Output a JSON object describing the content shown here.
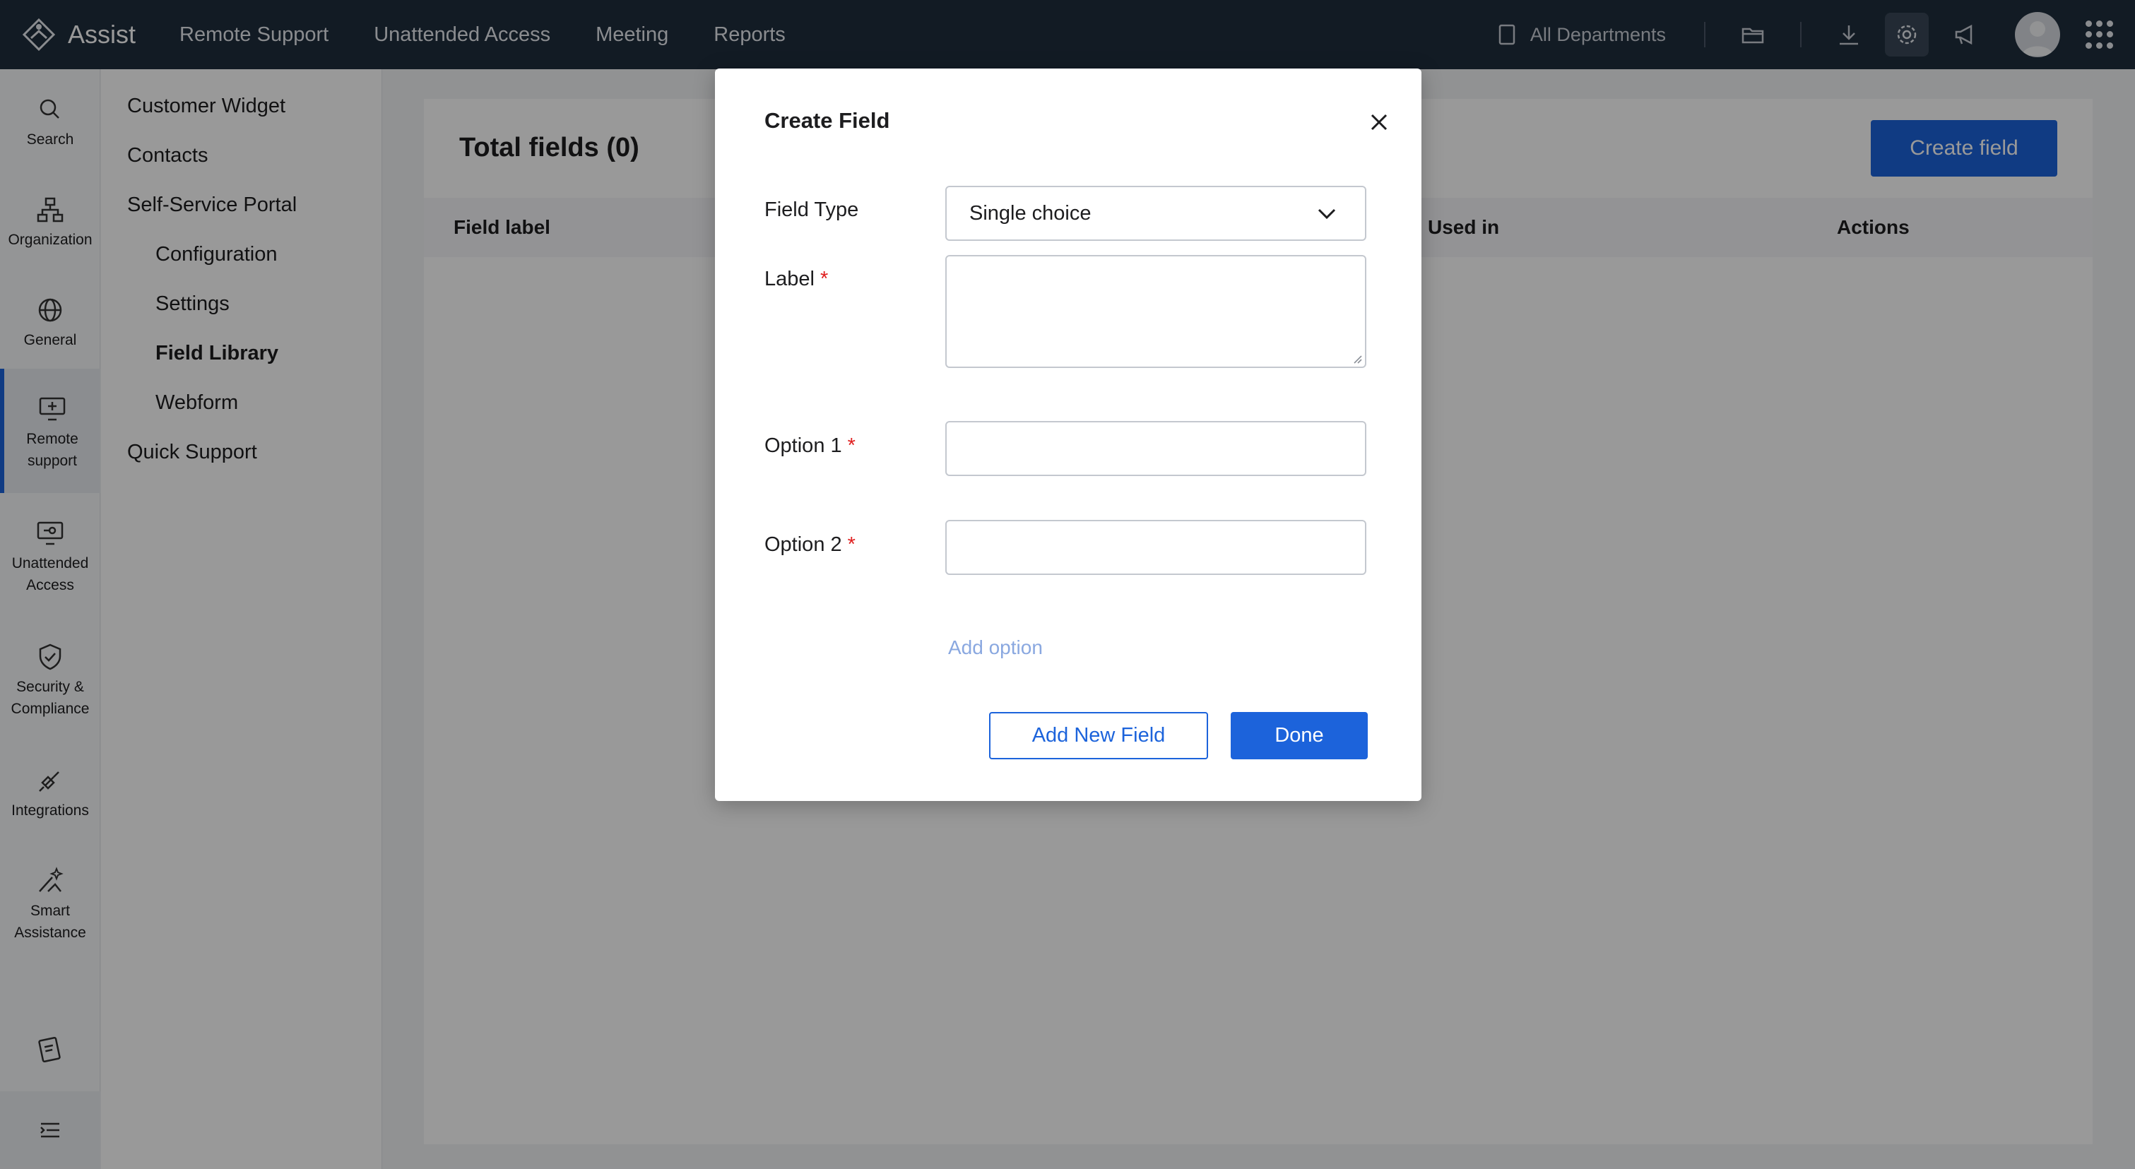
{
  "app": {
    "name": "Assist"
  },
  "topnav": {
    "items": [
      "Remote Support",
      "Unattended Access",
      "Meeting",
      "Reports"
    ],
    "department": "All Departments",
    "icons": [
      "folder-icon",
      "download-icon",
      "gear-icon",
      "megaphone-icon",
      "avatar",
      "apps-grid-icon"
    ]
  },
  "rail": {
    "items": [
      {
        "label": "Search",
        "icon": "search-icon"
      },
      {
        "label": "Organization",
        "icon": "org-chart-icon"
      },
      {
        "label": "General",
        "icon": "globe-icon"
      },
      {
        "label": "Remote support",
        "icon": "monitor-icon",
        "active": true
      },
      {
        "label": "Unattended Access",
        "icon": "monitor-key-icon"
      },
      {
        "label": "Security & Compliance",
        "icon": "shield-icon"
      },
      {
        "label": "Integrations",
        "icon": "plug-icon"
      },
      {
        "label": "Smart Assistance",
        "icon": "magic-icon"
      }
    ]
  },
  "menu": {
    "items": [
      {
        "label": "Customer Widget"
      },
      {
        "label": "Contacts"
      },
      {
        "label": "Self-Service Portal"
      },
      {
        "label": "Configuration"
      },
      {
        "label": "Settings"
      },
      {
        "label": "Field Library",
        "active": true
      },
      {
        "label": "Webform"
      },
      {
        "label": "Quick Support"
      }
    ]
  },
  "main": {
    "title": "Total fields (0)",
    "create_button": "Create field",
    "columns": [
      "Field label",
      "Used in",
      "Actions"
    ]
  },
  "modal": {
    "title": "Create Field",
    "field_type_label": "Field Type",
    "field_type_value": "Single choice",
    "label_label": "Label",
    "option1_label": "Option 1",
    "option2_label": "Option 2",
    "required_mark": "*",
    "add_option": "Add option",
    "add_new_field": "Add New Field",
    "done": "Done"
  },
  "colors": {
    "topbar": "#1f2d3d",
    "primary": "#1c63db",
    "required": "#e02020"
  }
}
